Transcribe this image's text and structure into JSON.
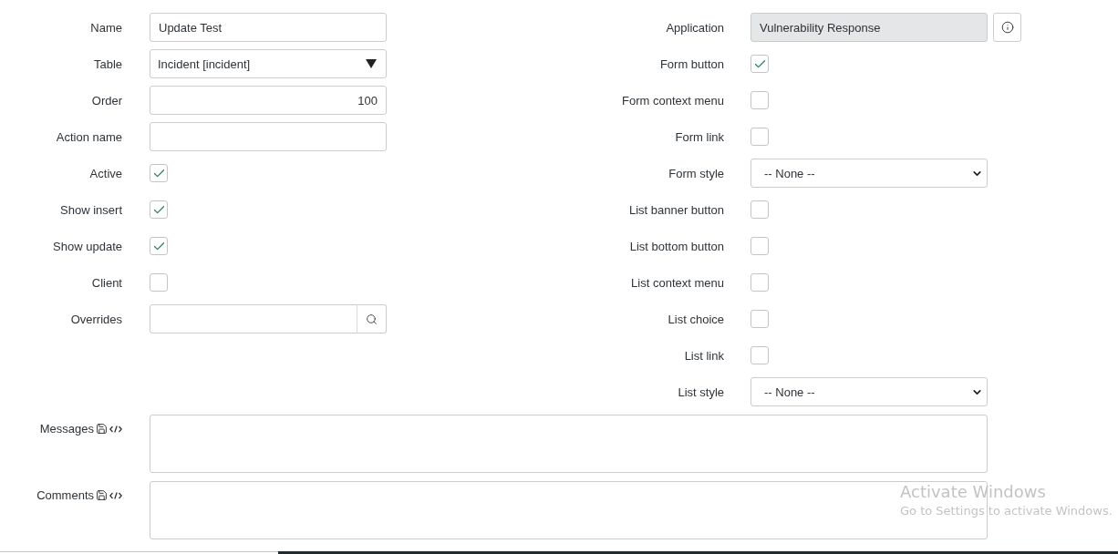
{
  "left_fields": [
    {
      "kind": "text",
      "label": "Name",
      "value": "Update Test"
    },
    {
      "kind": "choice",
      "label": "Table",
      "value": "Incident [incident]"
    },
    {
      "kind": "number",
      "label": "Order",
      "value": "100"
    },
    {
      "kind": "text",
      "label": "Action name"
    },
    {
      "kind": "checkbox",
      "label": "Active",
      "checked": true
    },
    {
      "kind": "checkbox",
      "label": "Show insert",
      "checked": true
    },
    {
      "kind": "checkbox",
      "label": "Show update",
      "checked": true
    },
    {
      "kind": "checkbox",
      "label": "Client",
      "checked": false
    },
    {
      "kind": "reference",
      "label": "Overrides"
    }
  ],
  "right_fields": [
    {
      "kind": "readonly",
      "label": "Application",
      "value": "Vulnerability Response"
    },
    {
      "kind": "checkbox",
      "label": "Form button",
      "checked": true
    },
    {
      "kind": "checkbox",
      "label": "Form context menu",
      "checked": false
    },
    {
      "kind": "checkbox",
      "label": "Form link",
      "checked": false
    },
    {
      "kind": "select",
      "label": "Form style",
      "value": "-- None --"
    },
    {
      "kind": "checkbox",
      "label": "List banner button",
      "checked": false
    },
    {
      "kind": "checkbox",
      "label": "List bottom button",
      "checked": false
    },
    {
      "kind": "checkbox",
      "label": "List context menu",
      "checked": false
    },
    {
      "kind": "checkbox",
      "label": "List choice",
      "checked": false
    },
    {
      "kind": "checkbox",
      "label": "List link",
      "checked": false
    },
    {
      "kind": "select",
      "label": "List style",
      "value": "-- None --"
    }
  ],
  "text_areas": [
    {
      "label": "Messages"
    },
    {
      "label": "Comments"
    }
  ],
  "os_notice": {
    "title": "Activate Windows",
    "subtitle": "Go to Settings to activate Windows."
  }
}
